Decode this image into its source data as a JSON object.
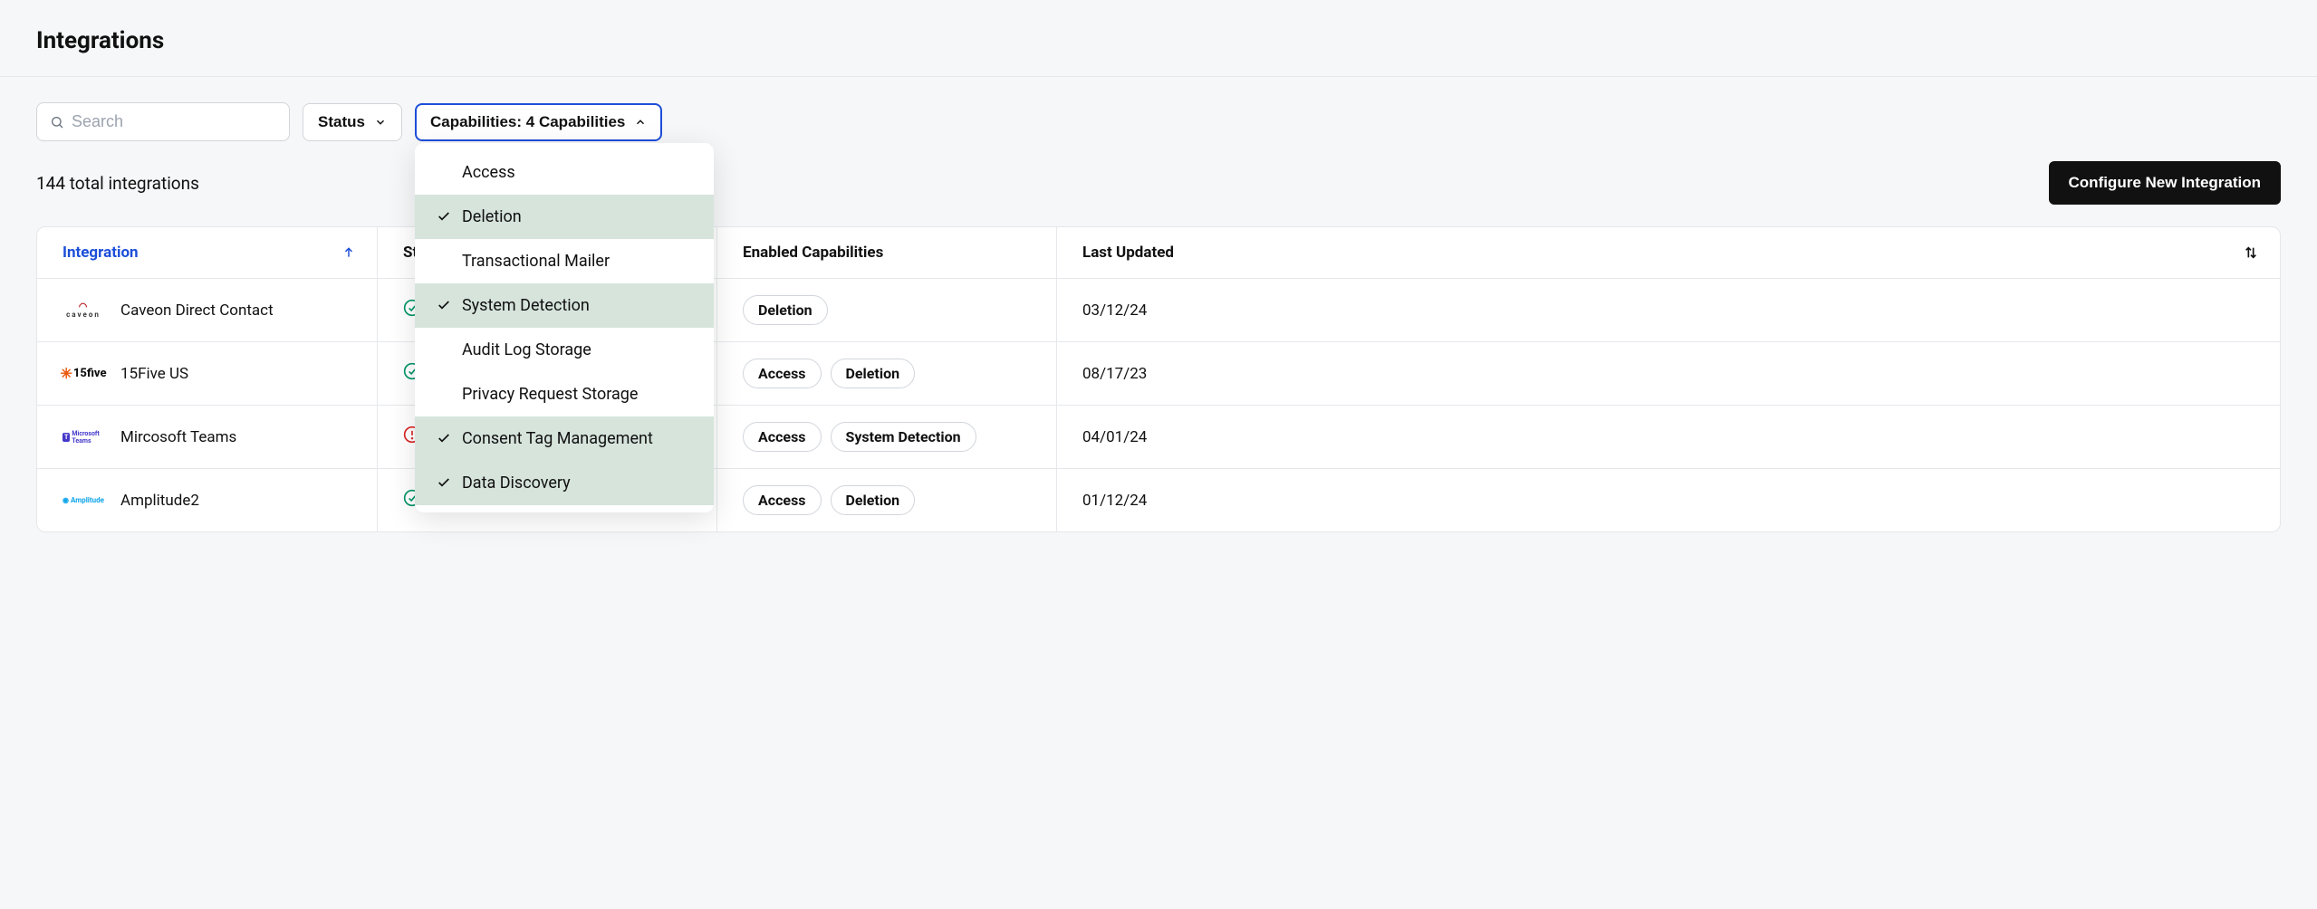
{
  "header": {
    "title": "Integrations"
  },
  "toolbar": {
    "search_placeholder": "Search",
    "status_label": "Status",
    "capabilities_label": "Capabilities: 4 Capabilities"
  },
  "subbar": {
    "total_text": "144 total integrations",
    "configure_label": "Configure New Integration"
  },
  "columns": {
    "integration": "Integration",
    "status": "Status",
    "enabled_caps": "Enabled Capabilities",
    "last_updated": "Last Updated"
  },
  "sort": {
    "active_column": "integration",
    "direction": "asc"
  },
  "rows": [
    {
      "logo": "caveon",
      "name": "Caveon Direct Contact",
      "status": "ok",
      "caps": [
        "Deletion"
      ],
      "updated": "03/12/24"
    },
    {
      "logo": "15five",
      "name": "15Five US",
      "status": "ok",
      "caps": [
        "Access",
        "Deletion"
      ],
      "updated": "08/17/23"
    },
    {
      "logo": "teams",
      "name": "Mircosoft Teams",
      "status": "error",
      "caps": [
        "Access",
        "System Detection"
      ],
      "updated": "04/01/24"
    },
    {
      "logo": "amplitude",
      "name": "Amplitude2",
      "status": "ok",
      "caps": [
        "Access",
        "Deletion"
      ],
      "updated": "01/12/24"
    }
  ],
  "capabilities_dropdown": {
    "open": true,
    "items": [
      {
        "label": "Access",
        "selected": false
      },
      {
        "label": "Deletion",
        "selected": true
      },
      {
        "label": "Transactional Mailer",
        "selected": false
      },
      {
        "label": "System Detection",
        "selected": true
      },
      {
        "label": "Audit Log Storage",
        "selected": false
      },
      {
        "label": "Privacy Request Storage",
        "selected": false
      },
      {
        "label": "Consent Tag Management",
        "selected": true
      },
      {
        "label": "Data Discovery",
        "selected": true
      }
    ]
  }
}
